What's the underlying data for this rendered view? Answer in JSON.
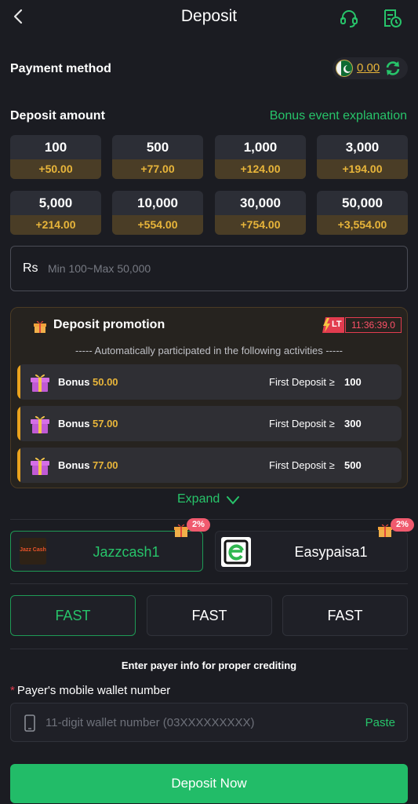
{
  "header": {
    "title": "Deposit",
    "back_icon": "chevron-left-icon",
    "support_icon": "headset-icon",
    "history_icon": "records-clock-icon"
  },
  "payment_method": {
    "label": "Payment method",
    "balance": "0.00",
    "currency_flag": "pakistan-flag",
    "refresh_icon": "refresh-icon"
  },
  "deposit_amount": {
    "label": "Deposit amount",
    "bonus_link": "Bonus event explanation",
    "options": [
      {
        "amount": "100",
        "bonus": "+50.00"
      },
      {
        "amount": "500",
        "bonus": "+77.00"
      },
      {
        "amount": "1,000",
        "bonus": "+124.00"
      },
      {
        "amount": "3,000",
        "bonus": "+194.00"
      },
      {
        "amount": "5,000",
        "bonus": "+214.00"
      },
      {
        "amount": "10,000",
        "bonus": "+554.00"
      },
      {
        "amount": "30,000",
        "bonus": "+754.00"
      },
      {
        "amount": "50,000",
        "bonus": "+3,554.00"
      }
    ],
    "currency_symbol": "Rs",
    "placeholder": "Min 100~Max 50,000"
  },
  "promotion": {
    "title": "Deposit promotion",
    "badge": "LT",
    "timer": "11:36:39.0",
    "subtitle": "----- Automatically participated in the following activities -----",
    "rows": [
      {
        "bonus_label": "Bonus",
        "bonus_amount": "50.00",
        "condition": "First Deposit ≥",
        "min": "100"
      },
      {
        "bonus_label": "Bonus",
        "bonus_amount": "57.00",
        "condition": "First Deposit ≥",
        "min": "300"
      },
      {
        "bonus_label": "Bonus",
        "bonus_amount": "77.00",
        "condition": "First Deposit ≥",
        "min": "500"
      }
    ],
    "expand_label": "Expand"
  },
  "payment_channels": [
    {
      "name": "Jazzcash1",
      "bonus_pct": "2%",
      "logo_text": "Jazz Cash",
      "selected": true
    },
    {
      "name": "Easypaisa1",
      "bonus_pct": "2%",
      "selected": false
    }
  ],
  "speed_options": [
    {
      "label": "FAST",
      "selected": true
    },
    {
      "label": "FAST",
      "selected": false
    },
    {
      "label": "FAST",
      "selected": false
    }
  ],
  "payer_info": {
    "hint": "Enter payer info for proper crediting",
    "required_mark": "*",
    "field_label": "Payer's mobile wallet number",
    "placeholder": "11-digit wallet number (03XXXXXXXXX)",
    "paste_label": "Paste"
  },
  "submit": {
    "label": "Deposit Now"
  },
  "colors": {
    "accent_green": "#22bc68",
    "gold": "#e8b53a",
    "background": "#1b1c22",
    "danger": "#e23c4f"
  }
}
